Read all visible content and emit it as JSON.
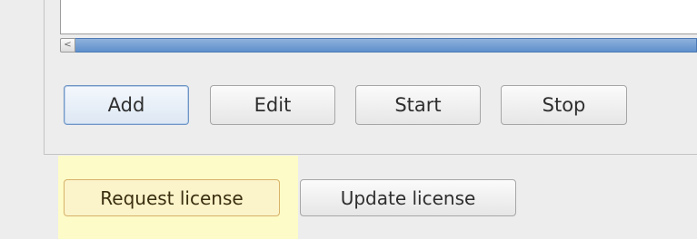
{
  "scroll": {
    "left_arrow": "<"
  },
  "action_buttons": {
    "add": "Add",
    "edit": "Edit",
    "start": "Start",
    "stop": "Stop"
  },
  "license_buttons": {
    "request": "Request license",
    "update": "Update license"
  },
  "colors": {
    "scroll_thumb": "#6f9bd1",
    "highlight": "#fdfbc7",
    "request_border": "#d6b26a"
  }
}
